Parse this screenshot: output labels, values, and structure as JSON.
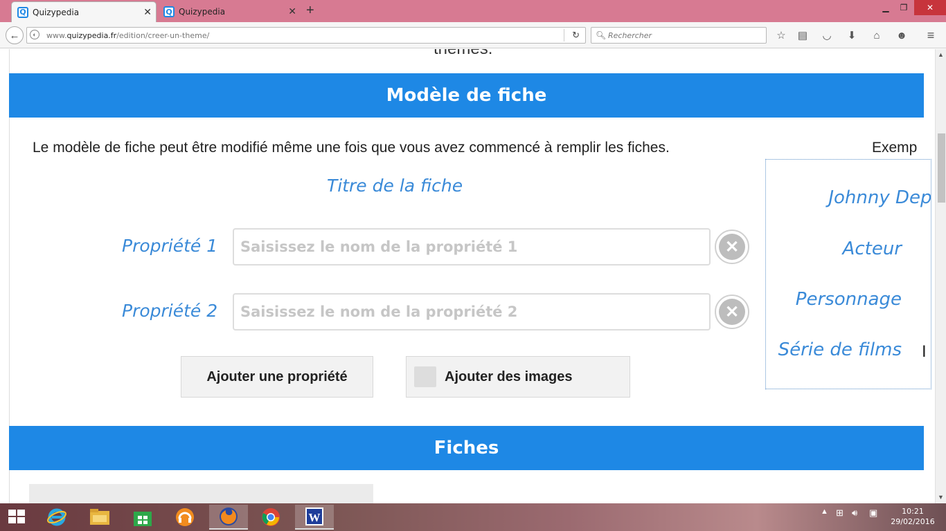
{
  "browser": {
    "tabs": [
      {
        "favicon": "Q",
        "title": "Quizypedia"
      },
      {
        "favicon": "Q",
        "title": "Quizypedia"
      }
    ],
    "url_prefix": "www.",
    "url_domain": "quizypedia.fr",
    "url_path": "/edition/creer-un-theme/",
    "search_placeholder": "Rechercher"
  },
  "page": {
    "themes_cut_text": "thèmes.",
    "modele_header": "Modèle de fiche",
    "description": "Le modèle de fiche peut être modifié même une fois que vous avez commencé à remplir les fiches.",
    "example_heading": "Exemp",
    "fiche_title": "Titre de la fiche",
    "properties": [
      {
        "label": "Propriété 1",
        "placeholder": "Saisissez le nom de la propriété 1"
      },
      {
        "label": "Propriété 2",
        "placeholder": "Saisissez le nom de la propriété 2"
      }
    ],
    "add_property_label": "Ajouter une propriété",
    "add_images_label": "Ajouter des images",
    "example": {
      "title": "Johnny Depp",
      "rows": [
        "Acteur",
        "Personnage",
        "Série de films"
      ],
      "trailing_char": "I"
    },
    "fiches_header": "Fiches"
  },
  "taskbar": {
    "time": "10:21",
    "date": "29/02/2016"
  },
  "colors": {
    "banner": "#1e88e5",
    "accent_text": "#3a8ad8",
    "tabstrip": "#d77a92"
  },
  "icons": {
    "back": "arrow-left-icon",
    "reload": "reload-icon",
    "search": "search-icon",
    "delete": "close-circle-icon"
  }
}
